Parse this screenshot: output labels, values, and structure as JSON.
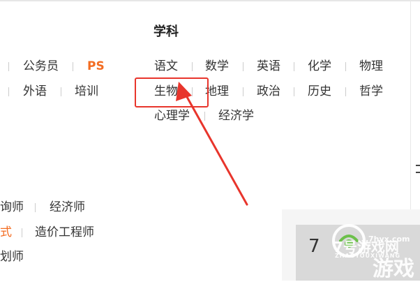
{
  "section": {
    "title": "学科"
  },
  "left_categories": {
    "row1": [
      "公务员",
      "PS"
    ],
    "row2": [
      "外语",
      "培训"
    ]
  },
  "subjects": {
    "row1": [
      "语文",
      "数学",
      "英语",
      "化学",
      "物理"
    ],
    "row2": [
      "生物",
      "地理",
      "政治",
      "历史",
      "哲学"
    ],
    "row3": [
      "心理学",
      "经济学"
    ]
  },
  "highlighted_subject": "生物",
  "bottom_left": {
    "row1_partial": "询师",
    "row1": "经济师",
    "row2_partial": "式",
    "row2": "造价工程师",
    "row3_partial": "划师"
  },
  "ad": {
    "digit": "7"
  },
  "watermark": {
    "line1": "7号游戏网",
    "line2": "ZHAOYOUXIWANG",
    "line3": "游戏",
    "url": "7hyx.com"
  },
  "colors": {
    "accent_orange": "#f36c21",
    "annotation_red": "#e8352c"
  }
}
